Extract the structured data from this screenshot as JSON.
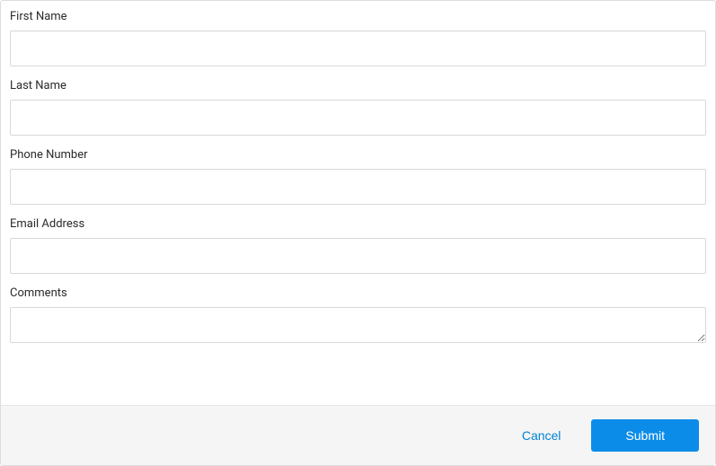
{
  "form": {
    "fields": {
      "first_name": {
        "label": "First Name",
        "value": ""
      },
      "last_name": {
        "label": "Last Name",
        "value": ""
      },
      "phone_number": {
        "label": "Phone Number",
        "value": ""
      },
      "email_address": {
        "label": "Email Address",
        "value": ""
      },
      "comments": {
        "label": "Comments",
        "value": ""
      }
    },
    "actions": {
      "cancel_label": "Cancel",
      "submit_label": "Submit"
    }
  }
}
